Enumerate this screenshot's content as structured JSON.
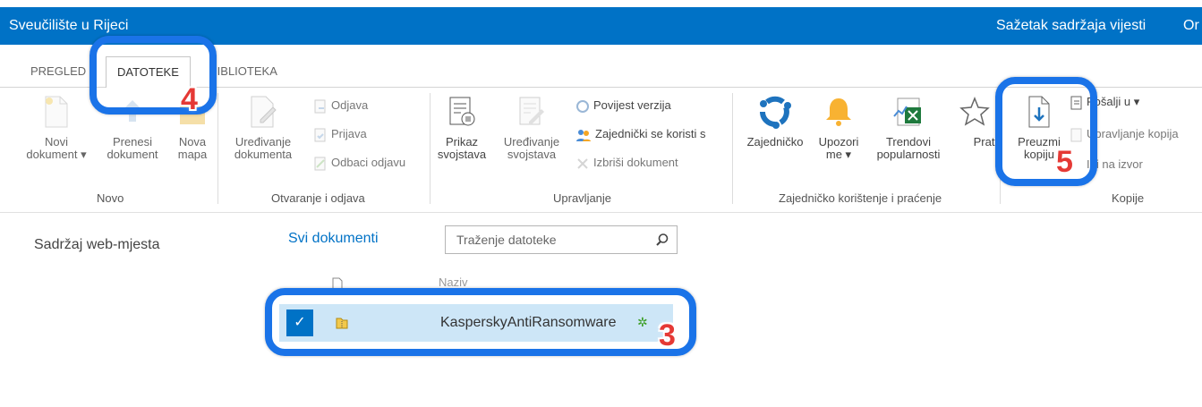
{
  "topbar": {
    "site_title": "Sveučilište u Rijeci",
    "right_link": "Sažetak sadržaja vijesti",
    "right_cut": "Or"
  },
  "tabs": [
    {
      "label": "PREGLED"
    },
    {
      "label": "DATOTEKE"
    },
    {
      "label": "BIBLIOTEKA"
    }
  ],
  "ribbon": {
    "novo": {
      "label": "Novo",
      "new_doc": "Novi\ndokument ▾",
      "upload": "Prenesi\ndokument",
      "new_folder": "Nova\nmapa"
    },
    "otvaranje": {
      "label": "Otvaranje i odjava",
      "edit_doc": "Uređivanje\ndokumenta",
      "check_out": "Odjava",
      "check_in": "Prijava",
      "discard": "Odbaci odjavu"
    },
    "upravljanje": {
      "label": "Upravljanje",
      "view_props": "Prikaz\nsvojstava",
      "edit_props": "Uređivanje\nsvojstava",
      "version_history": "Povijest verzija",
      "shared_with": "Zajednički se koristi s",
      "delete_doc": "Izbriši dokument"
    },
    "dijeljenje": {
      "label": "Zajedničko korištenje i praćenje",
      "share": "Zajedničko",
      "alert": "Upozori\nme ▾",
      "popularity": "Trendovi\npopularnosti",
      "follow": "Prati"
    },
    "kopije": {
      "label": "Kopije",
      "download": "Preuzmi\nkopiju",
      "send_to": "Pošalji u ▾",
      "manage_copies": "Upravljanje kopija",
      "go_source": "Idi na izvor"
    }
  },
  "content": {
    "site_contents": "Sadržaj web-mjesta",
    "all_docs": "Svi dokumenti",
    "search_placeholder": "Traženje datoteke",
    "header_name_faint": "Naziv",
    "file_name": "KasperskyAntiRansomware"
  },
  "annotations": {
    "n3": "3",
    "n4": "4",
    "n5": "5"
  },
  "colors": {
    "suite_bar": "#0072c6",
    "selection": "#cde6f7",
    "highlight": "#1a73e8",
    "number": "#e53935",
    "check_bg": "#0072c6"
  }
}
